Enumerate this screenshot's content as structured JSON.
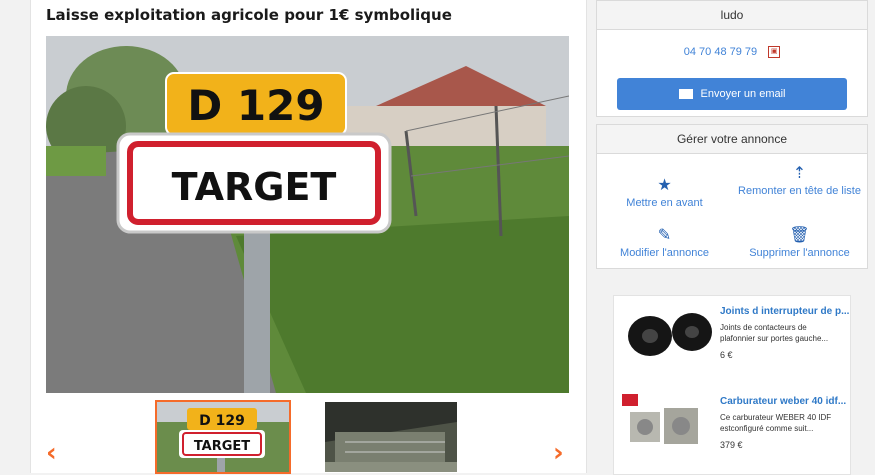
{
  "listing": {
    "title": "Laisse exploitation agricole pour 1€ symbolique"
  },
  "photo": {
    "sign_top": "D 129",
    "sign_main": "TARGET"
  },
  "thumbnails": [
    {
      "label_top": "D 129",
      "label_main": "TARGET"
    },
    {
      "label_top": "",
      "label_main": ""
    }
  ],
  "nav": {
    "prev": "‹",
    "next": "›"
  },
  "seller": {
    "name": "ludo",
    "phone": "04 70 48 79 79",
    "email_button": "Envoyer un email"
  },
  "manage": {
    "title": "Gérer votre annonce",
    "actions": [
      {
        "label": "Mettre en avant",
        "icon": "star-icon"
      },
      {
        "label": "Remonter en tête de liste",
        "icon": "sort-up-icon"
      },
      {
        "label": "Modifier l'annonce",
        "icon": "pencil-icon"
      },
      {
        "label": "Supprimer l'annonce",
        "icon": "trash-icon"
      }
    ]
  },
  "ads": [
    {
      "title": "Joints d interrupteur de p...",
      "desc": "Joints de contacteurs de plafonnier sur portes gauche...",
      "price": "6 €"
    },
    {
      "title": "Carburateur weber 40 idf...",
      "desc": "Ce carburateur WEBER 40 IDF estconfiguré comme suit...",
      "price": "379 €"
    }
  ],
  "colors": {
    "accent_orange": "#f56b2a",
    "link_blue": "#4183d7",
    "sign_red": "#d0202e",
    "sign_yellow": "#f2b21a"
  }
}
